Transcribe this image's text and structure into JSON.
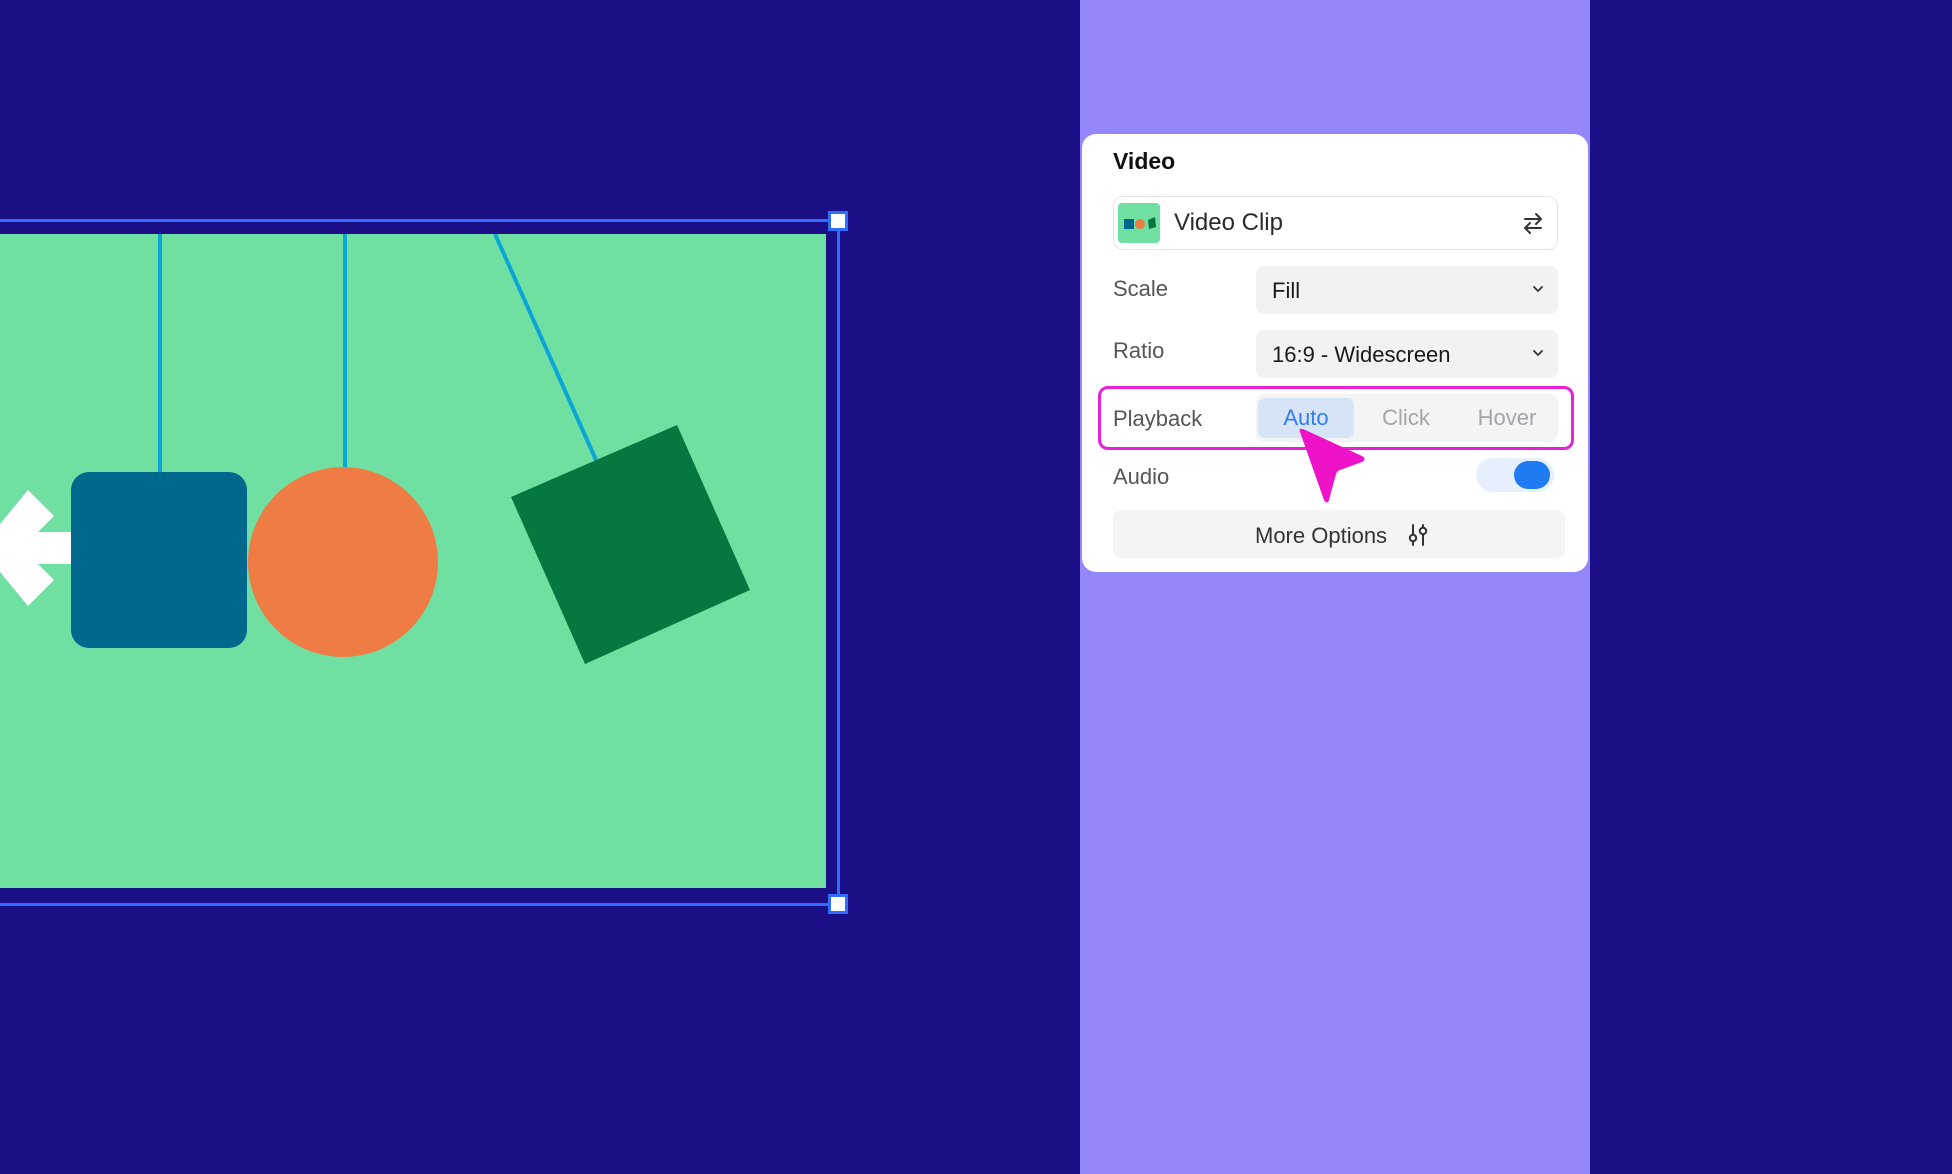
{
  "colors": {
    "background": "#1a0f86",
    "stripe": "#9486fb",
    "video_bg": "#6fe0a2",
    "accent": "#2e7ef0",
    "highlight": "#e820d8"
  },
  "panel": {
    "title": "Video",
    "clip": {
      "label": "Video Clip",
      "thumb_icon": "video-thumbnail",
      "swap_icon": "swap-icon"
    },
    "scale": {
      "label": "Scale",
      "value": "Fill"
    },
    "ratio": {
      "label": "Ratio",
      "value": "16:9 - Widescreen"
    },
    "playback": {
      "label": "Playback",
      "options": [
        "Auto",
        "Click",
        "Hover"
      ],
      "selected": "Auto"
    },
    "audio": {
      "label": "Audio",
      "enabled": true
    },
    "more_options": {
      "label": "More Options",
      "icon": "sliders-icon"
    }
  }
}
